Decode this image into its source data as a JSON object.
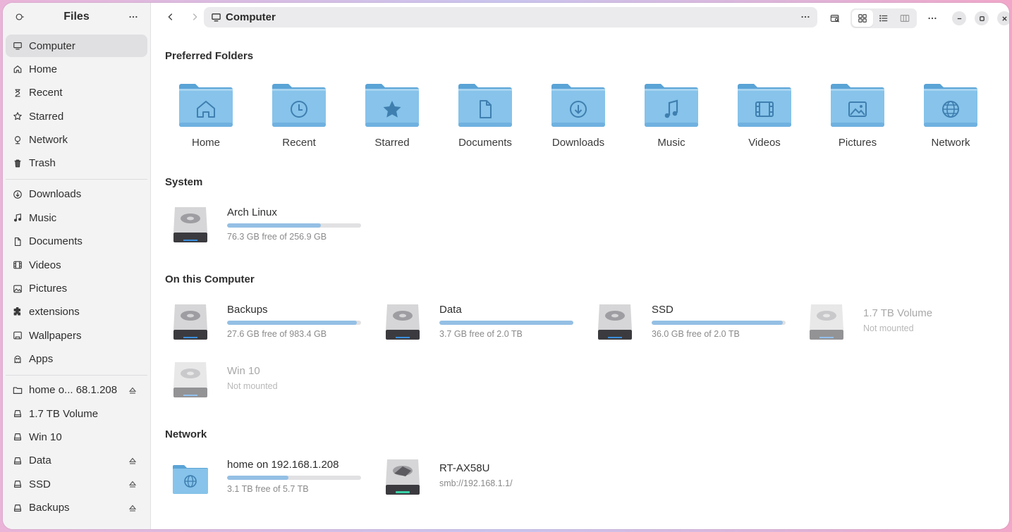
{
  "sidebar": {
    "title": "Files",
    "places": [
      {
        "label": "Computer",
        "icon": "computer-icon",
        "active": true
      },
      {
        "label": "Home",
        "icon": "home-icon"
      },
      {
        "label": "Recent",
        "icon": "recent-icon"
      },
      {
        "label": "Starred",
        "icon": "star-icon"
      },
      {
        "label": "Network",
        "icon": "network-icon"
      },
      {
        "label": "Trash",
        "icon": "trash-icon"
      }
    ],
    "bookmarks": [
      {
        "label": "Downloads",
        "icon": "download-icon"
      },
      {
        "label": "Music",
        "icon": "music-icon"
      },
      {
        "label": "Documents",
        "icon": "document-icon"
      },
      {
        "label": "Videos",
        "icon": "video-icon"
      },
      {
        "label": "Pictures",
        "icon": "picture-icon"
      },
      {
        "label": "extensions",
        "icon": "puzzle-icon"
      },
      {
        "label": "Wallpapers",
        "icon": "wallpaper-icon"
      },
      {
        "label": "Apps",
        "icon": "ghost-icon"
      }
    ],
    "devices": [
      {
        "label": "home o... 68.1.208",
        "icon": "folder-icon",
        "eject": true
      },
      {
        "label": "1.7 TB Volume",
        "icon": "drive-icon",
        "eject": false
      },
      {
        "label": "Win 10",
        "icon": "drive-icon",
        "eject": false
      },
      {
        "label": "Data",
        "icon": "drive-icon",
        "eject": true
      },
      {
        "label": "SSD",
        "icon": "drive-icon",
        "eject": true
      },
      {
        "label": "Backups",
        "icon": "drive-icon",
        "eject": true
      }
    ]
  },
  "toolbar": {
    "path": "Computer"
  },
  "sections": {
    "preferred": "Preferred Folders",
    "system": "System",
    "on_computer": "On this Computer",
    "network": "Network"
  },
  "folders": [
    {
      "label": "Home",
      "icon": "home-icon"
    },
    {
      "label": "Recent",
      "icon": "clock-icon"
    },
    {
      "label": "Starred",
      "icon": "star-icon"
    },
    {
      "label": "Documents",
      "icon": "document-icon"
    },
    {
      "label": "Downloads",
      "icon": "download-icon"
    },
    {
      "label": "Music",
      "icon": "music-icon"
    },
    {
      "label": "Videos",
      "icon": "film-icon"
    },
    {
      "label": "Pictures",
      "icon": "picture-icon"
    },
    {
      "label": "Network",
      "icon": "globe-icon"
    }
  ],
  "system_drives": [
    {
      "name": "Arch Linux",
      "info": "76.3 GB free of 256.9 GB",
      "used_fraction": 0.7
    }
  ],
  "computer_drives": [
    {
      "name": "Backups",
      "info": "27.6 GB free of 983.4 GB",
      "used_fraction": 0.97
    },
    {
      "name": "Data",
      "info": "3.7 GB free of 2.0 TB",
      "used_fraction": 0.998
    },
    {
      "name": "SSD",
      "info": "36.0 GB free of 2.0 TB",
      "used_fraction": 0.98
    },
    {
      "name": "1.7 TB Volume",
      "info": "Not mounted"
    },
    {
      "name": "Win 10",
      "info": "Not mounted"
    }
  ],
  "network_items": [
    {
      "name": "home on 192.168.1.208",
      "info": "3.1 TB free of 5.7 TB",
      "used_fraction": 0.46
    },
    {
      "name": "RT-AX58U",
      "info": "smb://192.168.1.1/"
    }
  ]
}
